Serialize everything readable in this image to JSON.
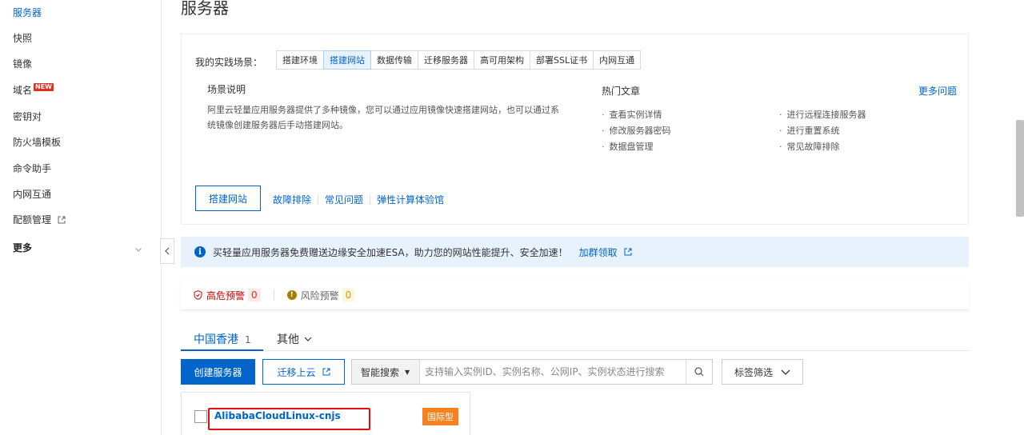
{
  "sidebar": {
    "items": [
      {
        "label": "服务器",
        "active": true
      },
      {
        "label": "快照"
      },
      {
        "label": "镜像"
      },
      {
        "label": "域名",
        "badge": "NEW"
      },
      {
        "label": "密钥对"
      },
      {
        "label": "防火墙模板"
      },
      {
        "label": "命令助手"
      },
      {
        "label": "内网互通"
      },
      {
        "label": "配额管理",
        "external": true
      },
      {
        "label": "更多",
        "expandable": true
      }
    ],
    "collapse_icon": "chevron-left-icon"
  },
  "page": {
    "title": "服务器"
  },
  "scenario": {
    "label": "我的实践场景：",
    "tabs": [
      "搭建环境",
      "搭建网站",
      "数据传输",
      "迁移服务器",
      "高可用架构",
      "部署SSL证书",
      "内网互通"
    ],
    "active_tab": "搭建网站",
    "desc_title": "场景说明",
    "desc_text": "阿里云轻量应用服务器提供了多种镜像，您可以通过应用镜像快速搭建网站，也可以通过系统镜像创建服务器后手动搭建网站。",
    "hot_title": "热门文章",
    "more_link": "更多问题",
    "hot_articles": [
      "查看实例详情",
      "修改服务器密码",
      "数据盘管理",
      "进行远程连接服务器",
      "进行重置系统",
      "常见故障排除"
    ],
    "build_button": "搭建网站",
    "links": [
      "故障排除",
      "常见问题",
      "弹性计算体验馆"
    ]
  },
  "info_bar": {
    "icon": "info-icon",
    "text": "买轻量应用服务器免费赠送边缘安全加速ESA，助力您的网站性能提升、安全加速！",
    "link": "加群领取"
  },
  "alerts": {
    "high_label": "高危预警",
    "high_count": "0",
    "risk_label": "风险预警",
    "risk_count": "0"
  },
  "regions": {
    "active_label": "中国香港",
    "active_count": "1",
    "other_label": "其他"
  },
  "toolbar": {
    "create_button": "创建服务器",
    "migrate_button": "迁移上云",
    "search_select": "智能搜索",
    "search_placeholder": "支持输入实例ID、实例名称、公网IP、实例状态进行搜索",
    "tag_filter": "标签筛选"
  },
  "server": {
    "name": "AlibabaCloudLinux-cnjs",
    "badge": "国际型"
  },
  "colors": {
    "accent": "#0064c8",
    "danger": "#e0301e",
    "badge_orange": "#f5821f",
    "info_bg": "#e8f2fc"
  }
}
